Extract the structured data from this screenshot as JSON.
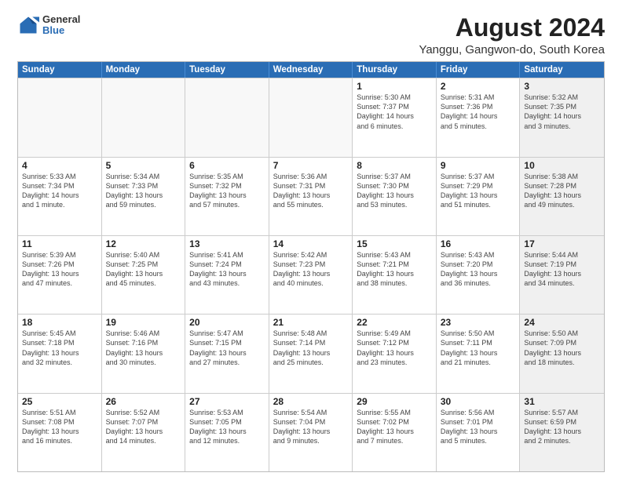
{
  "logo": {
    "general": "General",
    "blue": "Blue"
  },
  "title": "August 2024",
  "subtitle": "Yanggu, Gangwon-do, South Korea",
  "header_days": [
    "Sunday",
    "Monday",
    "Tuesday",
    "Wednesday",
    "Thursday",
    "Friday",
    "Saturday"
  ],
  "weeks": [
    [
      {
        "day": "",
        "info": "",
        "empty": true
      },
      {
        "day": "",
        "info": "",
        "empty": true
      },
      {
        "day": "",
        "info": "",
        "empty": true
      },
      {
        "day": "",
        "info": "",
        "empty": true
      },
      {
        "day": "1",
        "info": "Sunrise: 5:30 AM\nSunset: 7:37 PM\nDaylight: 14 hours\nand 6 minutes."
      },
      {
        "day": "2",
        "info": "Sunrise: 5:31 AM\nSunset: 7:36 PM\nDaylight: 14 hours\nand 5 minutes."
      },
      {
        "day": "3",
        "info": "Sunrise: 5:32 AM\nSunset: 7:35 PM\nDaylight: 14 hours\nand 3 minutes.",
        "shaded": true
      }
    ],
    [
      {
        "day": "4",
        "info": "Sunrise: 5:33 AM\nSunset: 7:34 PM\nDaylight: 14 hours\nand 1 minute."
      },
      {
        "day": "5",
        "info": "Sunrise: 5:34 AM\nSunset: 7:33 PM\nDaylight: 13 hours\nand 59 minutes."
      },
      {
        "day": "6",
        "info": "Sunrise: 5:35 AM\nSunset: 7:32 PM\nDaylight: 13 hours\nand 57 minutes."
      },
      {
        "day": "7",
        "info": "Sunrise: 5:36 AM\nSunset: 7:31 PM\nDaylight: 13 hours\nand 55 minutes."
      },
      {
        "day": "8",
        "info": "Sunrise: 5:37 AM\nSunset: 7:30 PM\nDaylight: 13 hours\nand 53 minutes."
      },
      {
        "day": "9",
        "info": "Sunrise: 5:37 AM\nSunset: 7:29 PM\nDaylight: 13 hours\nand 51 minutes."
      },
      {
        "day": "10",
        "info": "Sunrise: 5:38 AM\nSunset: 7:28 PM\nDaylight: 13 hours\nand 49 minutes.",
        "shaded": true
      }
    ],
    [
      {
        "day": "11",
        "info": "Sunrise: 5:39 AM\nSunset: 7:26 PM\nDaylight: 13 hours\nand 47 minutes."
      },
      {
        "day": "12",
        "info": "Sunrise: 5:40 AM\nSunset: 7:25 PM\nDaylight: 13 hours\nand 45 minutes."
      },
      {
        "day": "13",
        "info": "Sunrise: 5:41 AM\nSunset: 7:24 PM\nDaylight: 13 hours\nand 43 minutes."
      },
      {
        "day": "14",
        "info": "Sunrise: 5:42 AM\nSunset: 7:23 PM\nDaylight: 13 hours\nand 40 minutes."
      },
      {
        "day": "15",
        "info": "Sunrise: 5:43 AM\nSunset: 7:21 PM\nDaylight: 13 hours\nand 38 minutes."
      },
      {
        "day": "16",
        "info": "Sunrise: 5:43 AM\nSunset: 7:20 PM\nDaylight: 13 hours\nand 36 minutes."
      },
      {
        "day": "17",
        "info": "Sunrise: 5:44 AM\nSunset: 7:19 PM\nDaylight: 13 hours\nand 34 minutes.",
        "shaded": true
      }
    ],
    [
      {
        "day": "18",
        "info": "Sunrise: 5:45 AM\nSunset: 7:18 PM\nDaylight: 13 hours\nand 32 minutes."
      },
      {
        "day": "19",
        "info": "Sunrise: 5:46 AM\nSunset: 7:16 PM\nDaylight: 13 hours\nand 30 minutes."
      },
      {
        "day": "20",
        "info": "Sunrise: 5:47 AM\nSunset: 7:15 PM\nDaylight: 13 hours\nand 27 minutes."
      },
      {
        "day": "21",
        "info": "Sunrise: 5:48 AM\nSunset: 7:14 PM\nDaylight: 13 hours\nand 25 minutes."
      },
      {
        "day": "22",
        "info": "Sunrise: 5:49 AM\nSunset: 7:12 PM\nDaylight: 13 hours\nand 23 minutes."
      },
      {
        "day": "23",
        "info": "Sunrise: 5:50 AM\nSunset: 7:11 PM\nDaylight: 13 hours\nand 21 minutes."
      },
      {
        "day": "24",
        "info": "Sunrise: 5:50 AM\nSunset: 7:09 PM\nDaylight: 13 hours\nand 18 minutes.",
        "shaded": true
      }
    ],
    [
      {
        "day": "25",
        "info": "Sunrise: 5:51 AM\nSunset: 7:08 PM\nDaylight: 13 hours\nand 16 minutes."
      },
      {
        "day": "26",
        "info": "Sunrise: 5:52 AM\nSunset: 7:07 PM\nDaylight: 13 hours\nand 14 minutes."
      },
      {
        "day": "27",
        "info": "Sunrise: 5:53 AM\nSunset: 7:05 PM\nDaylight: 13 hours\nand 12 minutes."
      },
      {
        "day": "28",
        "info": "Sunrise: 5:54 AM\nSunset: 7:04 PM\nDaylight: 13 hours\nand 9 minutes."
      },
      {
        "day": "29",
        "info": "Sunrise: 5:55 AM\nSunset: 7:02 PM\nDaylight: 13 hours\nand 7 minutes."
      },
      {
        "day": "30",
        "info": "Sunrise: 5:56 AM\nSunset: 7:01 PM\nDaylight: 13 hours\nand 5 minutes."
      },
      {
        "day": "31",
        "info": "Sunrise: 5:57 AM\nSunset: 6:59 PM\nDaylight: 13 hours\nand 2 minutes.",
        "shaded": true
      }
    ]
  ]
}
